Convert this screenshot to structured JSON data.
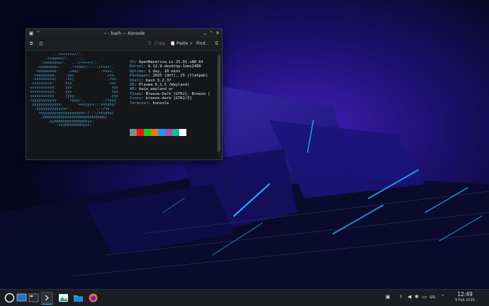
{
  "window": {
    "title": "~ : bash — Konsole",
    "toolbar": {
      "copy": "Copy",
      "paste": "Paste",
      "find": "Find..."
    }
  },
  "neofetch": {
    "logo": "            .:+++++++//:.\n        .++oooo+/:.   .--.\n      :+ooooooo/:.  .-:/+++++/:.\n    -+ooooooo+.    .:++oo+/:::::/++o+:.\n   .ooooooooo:    .+oo/.        .:+oo+.\n  .+oooooooo-    .oo/              .+so.\n  -sssssssss/    :ss/               .+ss.\n .sssssssss:     sss`               .sso\n sssssssssss:    yys`                 sys\n sssssssssss.    yys                  sys\n sssssssssss     /yyy:               .yys\n /yyyyyyyyyyy-    `+yyy/:.        ./+yyy`\n  yyyyyyyyyyyys:     .:+osyys+:::+osyhy/\n   .yyyyyyyyyyyyy+-.       ``  .-:/oo.\n     +yyyyyyyyyyyyyyyyyyo+:/:::/+osyhy/\n      .hhhhhhhhhhhhhhhhhhhhhhhhhhhh/\n         .oyhhhhhhhhhhhhhhhyo:\n            .:+syhhhhhhhhys+:-",
    "fields": [
      {
        "key": "OS",
        "value": "OpenMandriva Lx 25.01 x86_64"
      },
      {
        "key": "Kernel",
        "value": "6.12.9-desktop-1omv2490"
      },
      {
        "key": "Uptime",
        "value": "1 day, 18 mins"
      },
      {
        "key": "Packages",
        "value": "2025 (dnf), 25 (flatpak)"
      },
      {
        "key": "Shell",
        "value": "bash 5.2.37"
      },
      {
        "key": "DE",
        "value": "Plasma 6.2.5 (Wayland)"
      },
      {
        "key": "WM",
        "value": "kwin_wayland_wr"
      },
      {
        "key": "Theme",
        "value": "Breeze-Dark [GTK2], Breeze ["
      },
      {
        "key": "Icons",
        "value": "breeze-dark [GTK2/3]"
      },
      {
        "key": "Terminal",
        "value": "konsole"
      }
    ],
    "swatches": [
      "#7f8c8d",
      "#ed1515",
      "#11d116",
      "#f67400",
      "#1d99f3",
      "#9b59b6",
      "#1abc9c",
      "#fcfcfc"
    ]
  },
  "panel": {
    "layout": "us",
    "time": "12:49",
    "date": "9 Feb 2025"
  }
}
